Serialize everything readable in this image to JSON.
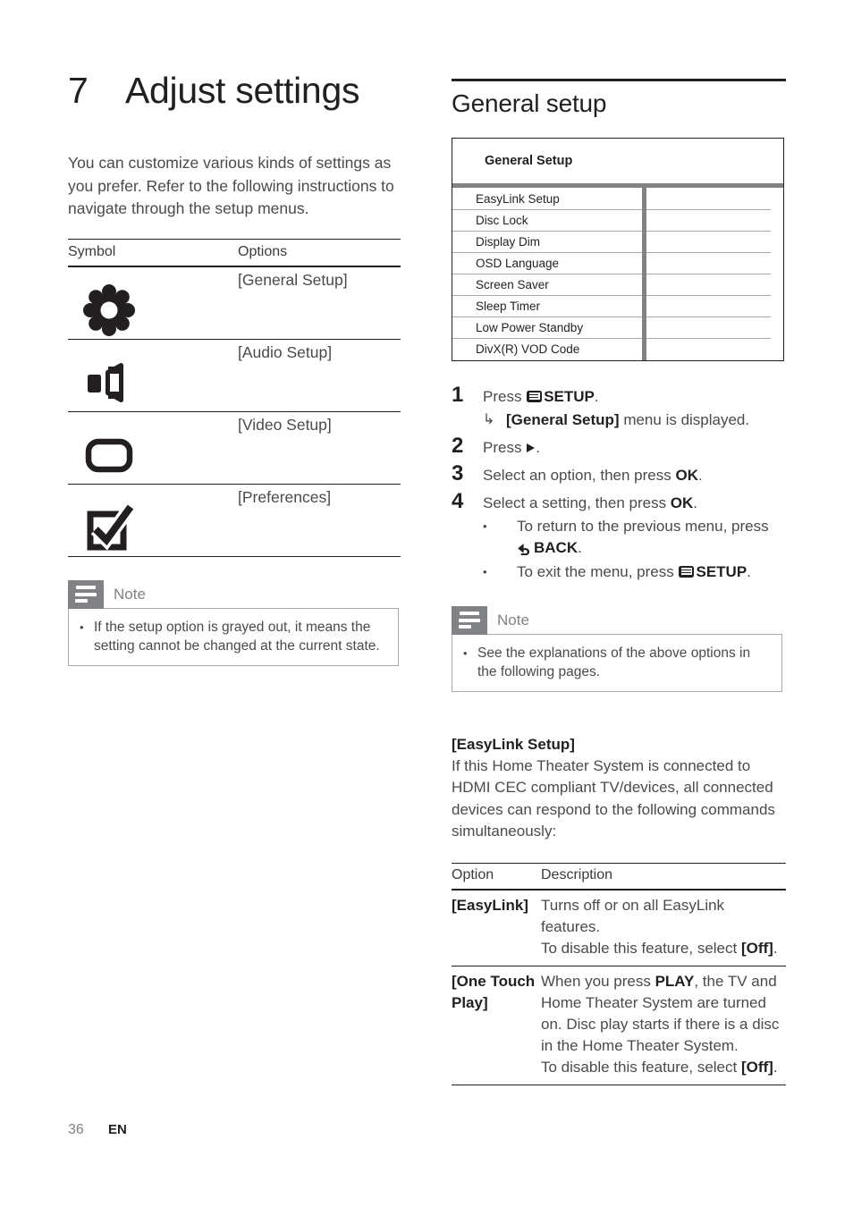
{
  "chapter": {
    "number": "7",
    "title": "Adjust settings",
    "intro": "You can customize various kinds of settings as you prefer. Refer to the following instructions to navigate through the setup menus."
  },
  "symbol_table": {
    "headers": [
      "Symbol",
      "Options"
    ],
    "rows": [
      {
        "icon": "gear-icon",
        "option": "[General Setup]"
      },
      {
        "icon": "speaker-icon",
        "option": "[Audio Setup]"
      },
      {
        "icon": "tv-screen-icon",
        "option": "[Video Setup]"
      },
      {
        "icon": "checkbox-checked-icon",
        "option": "[Preferences]"
      }
    ]
  },
  "note_left": {
    "label": "Note",
    "bullet": "•",
    "items": [
      "If the setup option is grayed out, it means the setting cannot be changed at the current state."
    ]
  },
  "section": {
    "title": "General setup"
  },
  "osd": {
    "title": "General Setup",
    "items": [
      "EasyLink Setup",
      "Disc Lock",
      "Display Dim",
      "OSD Language",
      "Screen Saver",
      "Sleep Timer",
      "Low Power Standby",
      "DivX(R) VOD Code"
    ]
  },
  "steps": [
    {
      "num": "1",
      "lead_text": "Press ",
      "icon": "setup-menu-icon",
      "bold": "SETUP",
      "tail": ".",
      "sub_arrow": {
        "glyph": "↳",
        "bold": "[General Setup]",
        "text": " menu is displayed."
      }
    },
    {
      "num": "2",
      "lead_text": "Press ",
      "icon": "right-arrow-icon",
      "bold": "",
      "tail": "."
    },
    {
      "num": "3",
      "lead_text": "Select an option, then press ",
      "bold": "OK",
      "tail": "."
    },
    {
      "num": "4",
      "lead_text": "Select a setting, then press ",
      "bold": "OK",
      "tail": ".",
      "bullets": [
        {
          "dot": "•",
          "pre": "To return to the previous menu, press ",
          "icon": "back-arrow-icon",
          "bold": "BACK",
          "post": "."
        },
        {
          "dot": "•",
          "pre": "To exit the menu, press ",
          "icon": "setup-menu-icon",
          "bold": "SETUP",
          "post": "."
        }
      ]
    }
  ],
  "note_right": {
    "label": "Note",
    "bullet": "•",
    "items": [
      "See the explanations of the above options in the following pages."
    ]
  },
  "easylink": {
    "heading": "[EasyLink Setup]",
    "paragraph": "If this Home Theater System is connected to HDMI CEC compliant TV/devices, all connected devices can respond to the following commands simultaneously:"
  },
  "option_table": {
    "headers": [
      "Option",
      "Description"
    ],
    "rows": [
      {
        "option": "[EasyLink]",
        "lines": [
          {
            "text": "Turns off or on all EasyLink features."
          },
          {
            "text": "To disable this feature, select "
          },
          {
            "bold": "[Off]",
            "text": "."
          }
        ]
      },
      {
        "option": "[One Touch Play]",
        "lines": [
          {
            "pre": "When you press ",
            "bold": "PLAY",
            "text": ", the TV and Home Theater System are turned on. Disc play starts if there is a disc in the Home Theater System."
          },
          {
            "text": "To disable this feature, select "
          },
          {
            "bold": "[Off]",
            "text": "."
          }
        ]
      }
    ]
  },
  "footer": {
    "page": "36",
    "language": "EN"
  },
  "colors": {
    "text": "#4a4a4d",
    "heading": "#231f20",
    "note_badge": "#808285",
    "rule": "#231f20",
    "osd_divider": "#808285"
  }
}
